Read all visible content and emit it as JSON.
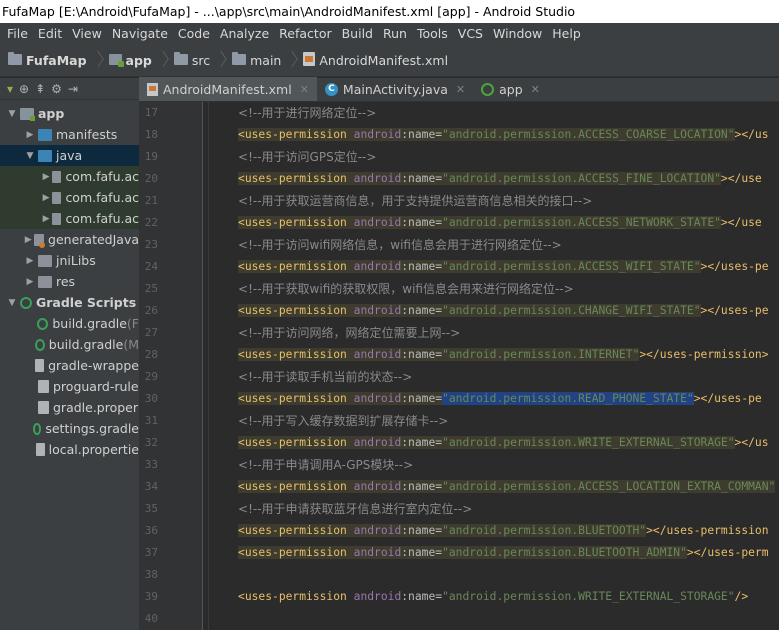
{
  "window": {
    "title": "FufaMap [E:\\Android\\FufaMap] - ...\\app\\src\\main\\AndroidManifest.xml [app] - Android Studio"
  },
  "menu": [
    "File",
    "Edit",
    "View",
    "Navigate",
    "Code",
    "Analyze",
    "Refactor",
    "Build",
    "Run",
    "Tools",
    "VCS",
    "Window",
    "Help"
  ],
  "breadcrumb": [
    "FufaMap",
    "app",
    "src",
    "main",
    "AndroidManifest.xml"
  ],
  "tabs": [
    {
      "label": "AndroidManifest.xml",
      "icon": "xml-file-icon",
      "active": true
    },
    {
      "label": "MainActivity.java",
      "icon": "class-icon",
      "active": false
    },
    {
      "label": "app",
      "icon": "module-icon",
      "active": false
    }
  ],
  "project_tree": [
    {
      "label": "app",
      "indent": 0,
      "arrow": "▼",
      "icon": "module"
    },
    {
      "label": "manifests",
      "indent": 1,
      "arrow": "▶",
      "icon": "folder-blue"
    },
    {
      "label": "java",
      "indent": 1,
      "arrow": "▼",
      "icon": "folder-blue"
    },
    {
      "label": "com.fafu.ac",
      "indent": 2,
      "arrow": "▶",
      "icon": "pkg"
    },
    {
      "label": "com.fafu.ac",
      "indent": 2,
      "arrow": "▶",
      "icon": "pkg"
    },
    {
      "label": "com.fafu.ac",
      "indent": 2,
      "arrow": "▶",
      "icon": "pkg"
    },
    {
      "label": "generatedJava",
      "indent": 1,
      "arrow": "▶",
      "icon": "gen"
    },
    {
      "label": "jniLibs",
      "indent": 1,
      "arrow": "▶",
      "icon": "folder"
    },
    {
      "label": "res",
      "indent": 1,
      "arrow": "▶",
      "icon": "folder"
    },
    {
      "label": "Gradle Scripts",
      "indent": 0,
      "arrow": "▼",
      "icon": "gradle"
    },
    {
      "label": "build.gradle",
      "suffix": " (F",
      "indent": 1,
      "arrow": "",
      "icon": "gradle"
    },
    {
      "label": "build.gradle",
      "suffix": " (M",
      "indent": 1,
      "arrow": "",
      "icon": "gradle"
    },
    {
      "label": "gradle-wrappe",
      "indent": 1,
      "arrow": "",
      "icon": "file"
    },
    {
      "label": "proguard-rule",
      "indent": 1,
      "arrow": "",
      "icon": "file"
    },
    {
      "label": "gradle.proper",
      "indent": 1,
      "arrow": "",
      "icon": "file"
    },
    {
      "label": "settings.gradle",
      "indent": 1,
      "arrow": "",
      "icon": "gradle"
    },
    {
      "label": "local.propertie",
      "indent": 1,
      "arrow": "",
      "icon": "file"
    }
  ],
  "code_lines": [
    {
      "n": "17",
      "type": "comment",
      "text": "<!--用于进行网络定位-->"
    },
    {
      "n": "18",
      "type": "perm",
      "name": "android.permission.ACCESS_COARSE_LOCATION",
      "tail": "></us"
    },
    {
      "n": "19",
      "type": "comment",
      "text": "<!--用于访问GPS定位-->"
    },
    {
      "n": "20",
      "type": "perm",
      "name": "android.permission.ACCESS_FINE_LOCATION",
      "tail": "></use"
    },
    {
      "n": "21",
      "type": "comment",
      "text": "<!--用于获取运营商信息，用于支持提供运营商信息相关的接口-->"
    },
    {
      "n": "22",
      "type": "perm",
      "name": "android.permission.ACCESS_NETWORK_STATE",
      "tail": "></use"
    },
    {
      "n": "23",
      "type": "comment",
      "text": "<!--用于访问wifi网络信息，wifi信息会用于进行网络定位-->"
    },
    {
      "n": "24",
      "type": "perm",
      "name": "android.permission.ACCESS_WIFI_STATE",
      "tail": "></uses-pe"
    },
    {
      "n": "25",
      "type": "comment",
      "text": "<!--用于获取wifi的获取权限，wifi信息会用来进行网络定位-->"
    },
    {
      "n": "26",
      "type": "perm",
      "name": "android.permission.CHANGE_WIFI_STATE",
      "tail": "></uses-pe"
    },
    {
      "n": "27",
      "type": "comment",
      "text": "<!--用于访问网络，网络定位需要上网-->"
    },
    {
      "n": "28",
      "type": "perm",
      "name": "android.permission.INTERNET",
      "tail": "></uses-permission>"
    },
    {
      "n": "29",
      "type": "comment",
      "text": "<!--用于读取手机当前的状态-->"
    },
    {
      "n": "30",
      "type": "perm",
      "name": "android.permission.READ_PHONE_STATE",
      "tail": "></uses-pe",
      "selected": true
    },
    {
      "n": "31",
      "type": "comment",
      "text": "<!--用于写入缓存数据到扩展存储卡-->"
    },
    {
      "n": "32",
      "type": "perm",
      "name": "android.permission.WRITE_EXTERNAL_STORAGE",
      "tail": "></us"
    },
    {
      "n": "33",
      "type": "comment",
      "text": "<!--用于申请调用A-GPS模块-->"
    },
    {
      "n": "34",
      "type": "perm",
      "name": "android.permission.ACCESS_LOCATION_EXTRA_COMMAN",
      "tail": ""
    },
    {
      "n": "35",
      "type": "comment",
      "text": "<!--用于申请获取蓝牙信息进行室内定位-->"
    },
    {
      "n": "36",
      "type": "perm",
      "name": "android.permission.BLUETOOTH",
      "tail": "></uses-permission"
    },
    {
      "n": "37",
      "type": "perm",
      "name": "android.permission.BLUETOOTH_ADMIN",
      "tail": "></uses-perm"
    },
    {
      "n": "38",
      "type": "blank"
    },
    {
      "n": "39",
      "type": "perm",
      "name": "android.permission.WRITE_EXTERNAL_STORAGE",
      "tail": "/>",
      "plain": true
    },
    {
      "n": "40",
      "type": "blank"
    }
  ],
  "code_tokens": {
    "tag": "uses-permission",
    "ns": "android",
    "attr": "name"
  }
}
